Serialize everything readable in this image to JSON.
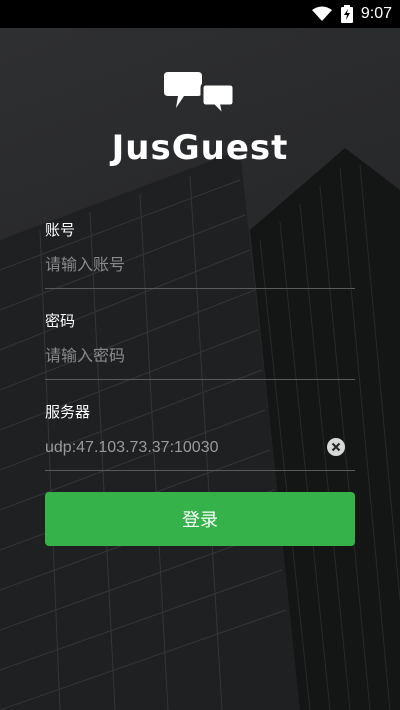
{
  "status_bar": {
    "time": "9:07"
  },
  "app": {
    "title": "JusGuest"
  },
  "form": {
    "account": {
      "label": "账号",
      "placeholder": "请输入账号",
      "value": ""
    },
    "password": {
      "label": "密码",
      "placeholder": "请输入密码",
      "value": ""
    },
    "server": {
      "label": "服务器",
      "placeholder": "",
      "value": "udp:47.103.73.37:10030"
    },
    "login_label": "登录"
  },
  "colors": {
    "accent": "#35b34a",
    "background": "#2a2b2d"
  }
}
